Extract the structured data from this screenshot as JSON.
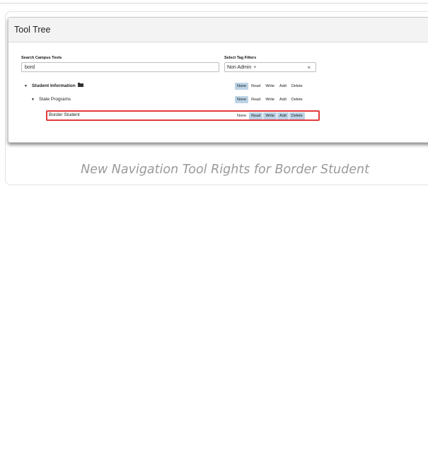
{
  "panel": {
    "title": "Tool Tree"
  },
  "search": {
    "label": "Search Campus Tools",
    "value": "bord"
  },
  "tag_filter": {
    "label": "Select Tag Filters",
    "chip": "Non Admin",
    "chip_remove": "×",
    "clear": "×"
  },
  "rights_labels": [
    "None",
    "Read",
    "Write",
    "Add",
    "Delete"
  ],
  "tree": [
    {
      "label": "Student Information",
      "expand": "▼",
      "icon": "folder-icon",
      "rights_on": [
        "None"
      ]
    },
    {
      "label": "State Programs",
      "expand": "▼",
      "rights_on": [
        "None"
      ]
    },
    {
      "label": "Border Student",
      "rights_on": [
        "Read",
        "Write",
        "Add",
        "Delete"
      ]
    }
  ],
  "caption": "New Navigation Tool Rights for Border Student",
  "colors": {
    "selected_right": "#bcd3e6",
    "highlight_border": "#e03a3a",
    "caption_text": "#9a9a9a"
  }
}
